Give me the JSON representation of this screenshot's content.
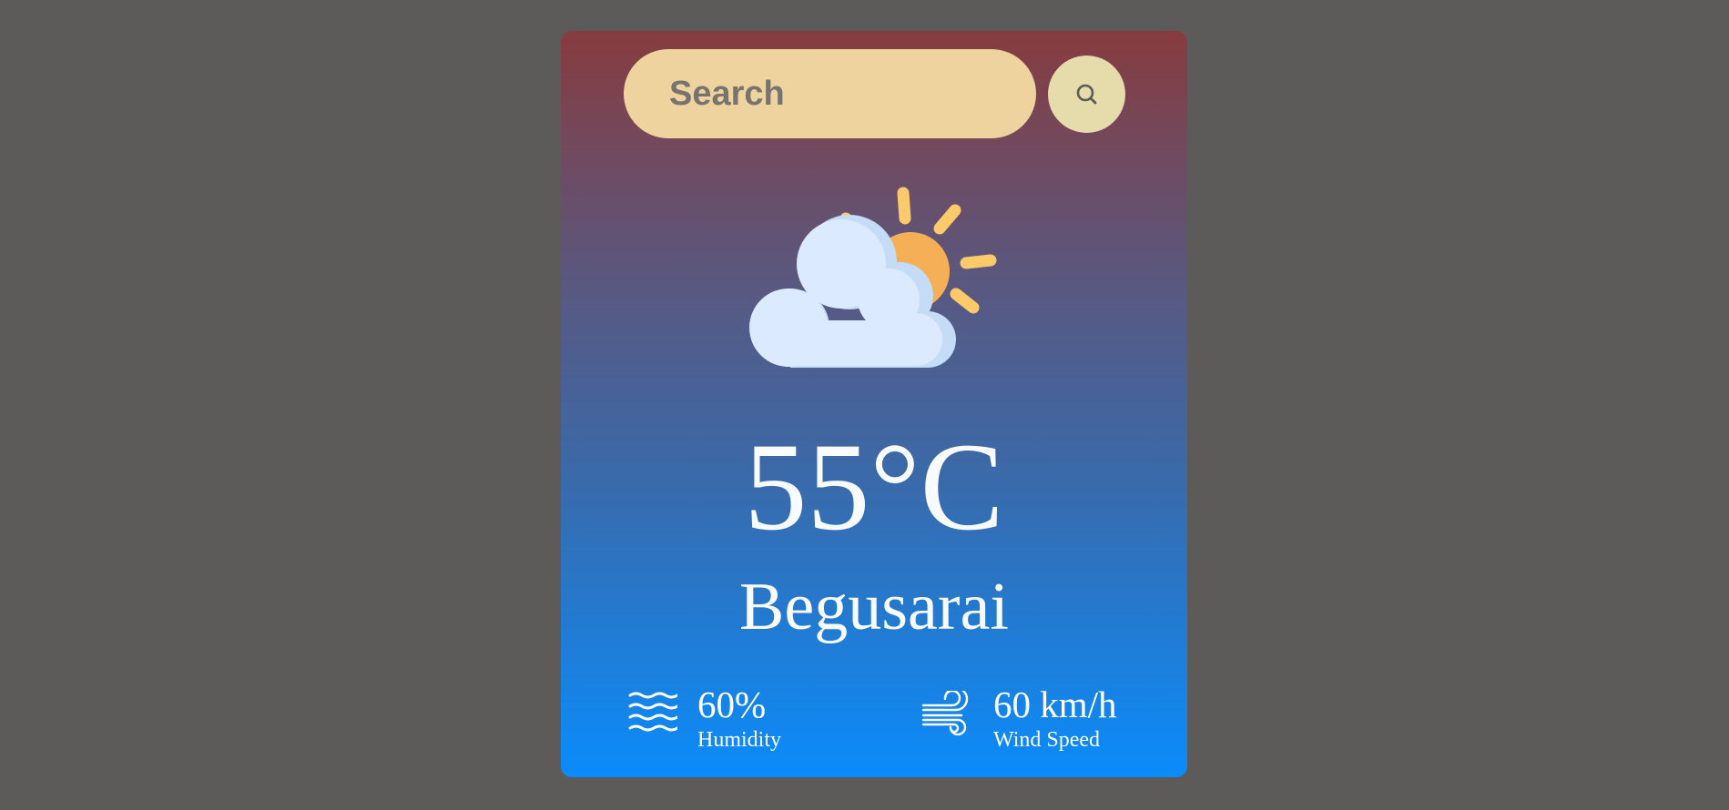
{
  "search": {
    "placeholder": "Search",
    "value": ""
  },
  "weather": {
    "icon": "partly-cloudy-icon",
    "temperature": "55°C",
    "city": "Begusarai"
  },
  "details": {
    "humidity": {
      "icon": "humidity-waves-icon",
      "value": "60%",
      "label": "Humidity"
    },
    "wind": {
      "icon": "wind-icon",
      "value": "60 km/h",
      "label": "Wind Speed"
    }
  },
  "colors": {
    "page_background": "#5c5b59",
    "card_gradient_top": "#873c3f",
    "card_gradient_bottom": "#0a8cfb",
    "search_field": "#efd39e",
    "search_button": "#e6dcab",
    "sun": "#f5b057",
    "sun_rays": "#fcca6a",
    "cloud": "#dbeaff"
  }
}
